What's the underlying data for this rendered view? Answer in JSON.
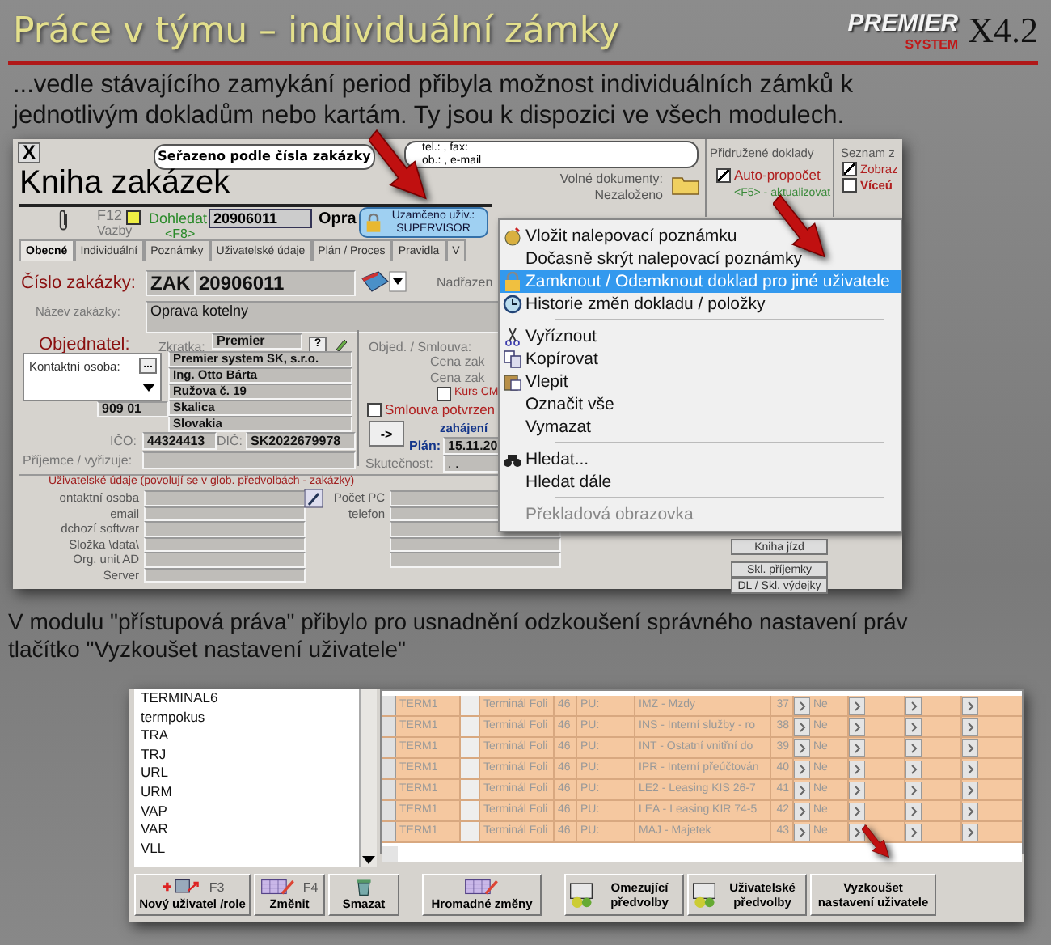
{
  "title": "Práce v týmu – individuální zámky",
  "logo": {
    "brand": "PREMIER",
    "sub": "SYSTEM",
    "version": "X4.2"
  },
  "intro": "...vedle stávajícího zamykání period přibyla možnost individuálních zámků k jednotlivým dokladům nebo kartám. Ty jsou k dispozici ve všech modulech.",
  "order_window": {
    "close": "X",
    "sort_callout": "Seřazeno podle čísla zakázky",
    "contact_callout": [
      "tel.: , fax:",
      "ob.: , e-mail"
    ],
    "title": "Kniha zakázek",
    "links_key": "F12",
    "links_label": "Vazby",
    "find_label": "Dohledat",
    "find_key": "<F8>",
    "find_value": "20906011",
    "cut_label": "Opra",
    "lock_badge": [
      "Uzamčeno uživ.:",
      "SUPERVISOR"
    ],
    "free_docs": {
      "label": "Volné dokumenty:",
      "value": "Nezaloženo"
    },
    "related": {
      "title": "Přidružené doklady",
      "auto_calc": {
        "label": "Auto-propočet",
        "checked": true
      },
      "hint": "<F5> - aktualizovat",
      "buttons": [
        "Kniha jízd",
        "Skl. příjemky",
        "DL / Skl. výdejky"
      ]
    },
    "list_panel": {
      "title": "Seznam z",
      "options": [
        {
          "label": "Zobraz",
          "checked": true
        },
        {
          "label": "Víceú",
          "checked": false
        }
      ]
    },
    "tabs": [
      {
        "label": "Obecné",
        "selected": true
      },
      {
        "label": "Individuální",
        "selected": false
      },
      {
        "label": "Poznámky",
        "selected": false
      },
      {
        "label": "Uživatelské údaje",
        "selected": false
      },
      {
        "label": "Plán / Proces",
        "selected": false
      },
      {
        "label": "Pravidla",
        "selected": false
      },
      {
        "label": "V",
        "selected": false
      }
    ],
    "order_no": {
      "label": "Číslo zakázky:",
      "prefix": "ZAK",
      "value": "20906011"
    },
    "parent_label": "Nadřazen",
    "name": {
      "label": "Název zakázky:",
      "value": "Oprava kotelny"
    },
    "customer": {
      "heading": "Objednatel:",
      "code_label": "Zkratka:",
      "code": "Premier",
      "help": "?",
      "contact_label": "Kontaktní osoba:",
      "contact_button": "...",
      "address": [
        "Premier system SK, s.r.o.",
        "Ing. Otto Bárta",
        "Ružova č. 19",
        "Skalica",
        "Slovakia"
      ],
      "zip": "909 01",
      "ico_label": "IČO:",
      "ico": "44324413",
      "dic_label": "DIČ:",
      "dic": "SK2022679978",
      "recipient_label": "Příjemce / vyřizuje:"
    },
    "contract": {
      "order_label": "Objed. / Smlouva:",
      "price_labels": [
        "Cena zak",
        "Cena zak"
      ],
      "rate": {
        "label": "Kurs CM",
        "checked": false
      },
      "confirmed": {
        "label": "Smlouva potvrzen",
        "checked": false
      },
      "go_button": "->",
      "start_label": "zahájení",
      "plan_label": "Plán:",
      "plan": "15.11.20",
      "actual_label": "Skutečnost:",
      "actual": ". ."
    },
    "user_data": {
      "heading": "Uživatelské údaje (povolují se v glob. předvolbách - zakázky)",
      "left_labels": [
        "ontaktní osoba",
        "email",
        "dchozí softwar",
        "Složka \\data\\",
        "Org. unit AD",
        "Server"
      ],
      "right_labels": [
        "Počet PC",
        "telefon"
      ]
    }
  },
  "context_menu": [
    {
      "kind": "item",
      "label": "Vložit nalepovací poznámku",
      "selected": false,
      "disabled": false
    },
    {
      "kind": "item",
      "label": "Dočasně skrýt nalepovací poznámky",
      "selected": false,
      "disabled": false
    },
    {
      "kind": "item",
      "label": "Zamknout / Odemknout doklad pro jiné uživatele",
      "selected": true,
      "disabled": false
    },
    {
      "kind": "item",
      "label": "Historie změn dokladu / položky",
      "selected": false,
      "disabled": false
    },
    {
      "kind": "separator"
    },
    {
      "kind": "item",
      "label": "Vyříznout",
      "selected": false,
      "disabled": false
    },
    {
      "kind": "item",
      "label": "Kopírovat",
      "selected": false,
      "disabled": false
    },
    {
      "kind": "item",
      "label": "Vlepit",
      "selected": false,
      "disabled": false
    },
    {
      "kind": "item",
      "label": "Označit vše",
      "selected": false,
      "disabled": false
    },
    {
      "kind": "item",
      "label": "Vymazat",
      "selected": false,
      "disabled": false
    },
    {
      "kind": "separator"
    },
    {
      "kind": "item",
      "label": "Hledat...",
      "selected": false,
      "disabled": false
    },
    {
      "kind": "item",
      "label": "Hledat dále",
      "selected": false,
      "disabled": false
    },
    {
      "kind": "separator"
    },
    {
      "kind": "item",
      "label": "Překladová obrazovka",
      "selected": false,
      "disabled": true
    }
  ],
  "section2": "V modulu \"přístupová práva\" přibylo pro usnadnění odzkoušení správného nastavení práv tlačítko \"Vyzkoušet nastavení uživatele\"",
  "rights_window": {
    "users": [
      "TERMINAL6",
      "termpokus",
      "TRA",
      "TRJ",
      "URL",
      "URM",
      "VAP",
      "VAR",
      "VLL"
    ],
    "rows": [
      {
        "terminal": "TERM1",
        "name": "Terminál Foli",
        "count": "46",
        "type": "PU:",
        "module": "IMZ - Mzdy",
        "no": "37",
        "value": "Ne"
      },
      {
        "terminal": "TERM1",
        "name": "Terminál Foli",
        "count": "46",
        "type": "PU:",
        "module": "INS - Interní služby - ro",
        "no": "38",
        "value": "Ne"
      },
      {
        "terminal": "TERM1",
        "name": "Terminál Foli",
        "count": "46",
        "type": "PU:",
        "module": "INT - Ostatní vnitřní do",
        "no": "39",
        "value": "Ne"
      },
      {
        "terminal": "TERM1",
        "name": "Terminál Foli",
        "count": "46",
        "type": "PU:",
        "module": "IPR - Interní přeúčtován",
        "no": "40",
        "value": "Ne"
      },
      {
        "terminal": "TERM1",
        "name": "Terminál Foli",
        "count": "46",
        "type": "PU:",
        "module": "LE2 - Leasing KIS 26-7",
        "no": "41",
        "value": "Ne"
      },
      {
        "terminal": "TERM1",
        "name": "Terminál Foli",
        "count": "46",
        "type": "PU:",
        "module": "LEA - Leasing KIR 74-5",
        "no": "42",
        "value": "Ne"
      },
      {
        "terminal": "TERM1",
        "name": "Terminál Foli",
        "count": "46",
        "type": "PU:",
        "module": "MAJ - Majetek",
        "no": "43",
        "value": "Ne"
      }
    ],
    "buttons": [
      {
        "kind": "new",
        "label": "Nový uživatel /role",
        "key": "F3"
      },
      {
        "kind": "edit",
        "label": "Změnit",
        "key": "F4"
      },
      {
        "kind": "delete",
        "label": "Smazat"
      },
      {
        "kind": "bulk",
        "label": "Hromadné změny"
      },
      {
        "kind": "prefs",
        "label": "Omezující předvolby"
      },
      {
        "kind": "prefs",
        "label": "Uživatelské předvolby"
      },
      {
        "kind": "text",
        "label": "Vyzkoušet nastavení uživatele"
      }
    ]
  }
}
